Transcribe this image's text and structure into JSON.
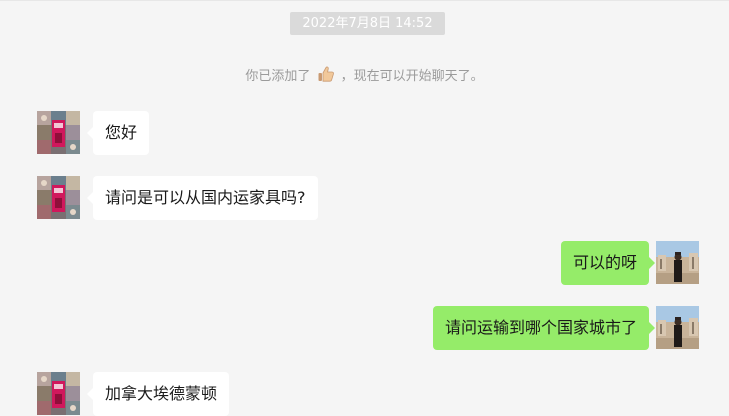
{
  "chat": {
    "timestamp": "2022年7月8日 14:52",
    "system_message": {
      "before": "你已添加了",
      "icon": "thumbs-up-emoji",
      "after": "，现在可以开始聊天了。"
    },
    "messages": [
      {
        "sender": "contact",
        "text": "您好"
      },
      {
        "sender": "contact",
        "text": "请问是可以从国内运家具吗?"
      },
      {
        "sender": "me",
        "text": "可以的呀"
      },
      {
        "sender": "me",
        "text": "请问运输到哪个国家城市了"
      },
      {
        "sender": "contact",
        "text": "加拿大埃德蒙顿"
      }
    ]
  },
  "colors": {
    "background": "#f5f5f5",
    "incoming_bubble": "#ffffff",
    "outgoing_bubble": "#95ec69",
    "timestamp_bg": "#dadada",
    "system_text": "#9b9b9b"
  }
}
